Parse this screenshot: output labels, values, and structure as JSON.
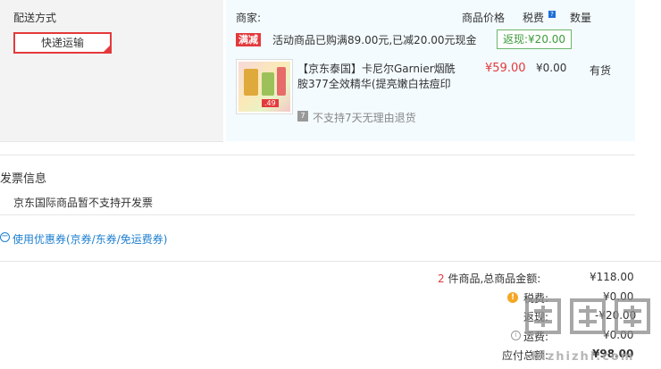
{
  "shipping": {
    "title": "配送方式",
    "method": "快递运输"
  },
  "header": {
    "seller_label": "商家:",
    "col_price": "商品价格",
    "col_tax": "税费",
    "col_qty": "数量"
  },
  "promo": {
    "tag": "满减",
    "text": "活动商品已购满89.00元,已减20.00元现金",
    "rebate": "返现:¥20.00"
  },
  "product": {
    "title_line1": "【京东泰国】卡尼尔Garnier烟酰",
    "title_line2": "胺377全效精华(提亮嫩白祛痘印",
    "price": "¥59.00",
    "tax": "¥0.00",
    "stock": "有货",
    "no_return": "不支持7天无理由退货",
    "thumb_price": ".49"
  },
  "invoice": {
    "title": "发票信息",
    "note": "京东国际商品暂不支持开发票"
  },
  "coupon": {
    "label": "使用优惠券(京券/东券/免运费券)"
  },
  "summary": {
    "count": "2",
    "count_suffix": "件商品,总商品金额:",
    "goods_total": "¥118.00",
    "tax_label": "税费:",
    "tax_value": "¥0.00",
    "rebate_label": "返现:",
    "rebate_value": "-¥20.00",
    "freight_label": "运费:",
    "freight_value": "¥0.00",
    "payable_label": "应付总额:",
    "payable_value": "¥98.00"
  },
  "watermark": {
    "text": "hizhizhi.com"
  },
  "colors": {
    "accent_red": "#e4393c",
    "panel_blue": "#f3fbfe",
    "rebate_green": "#3b9b3b",
    "link_blue": "#1e7fcf"
  }
}
